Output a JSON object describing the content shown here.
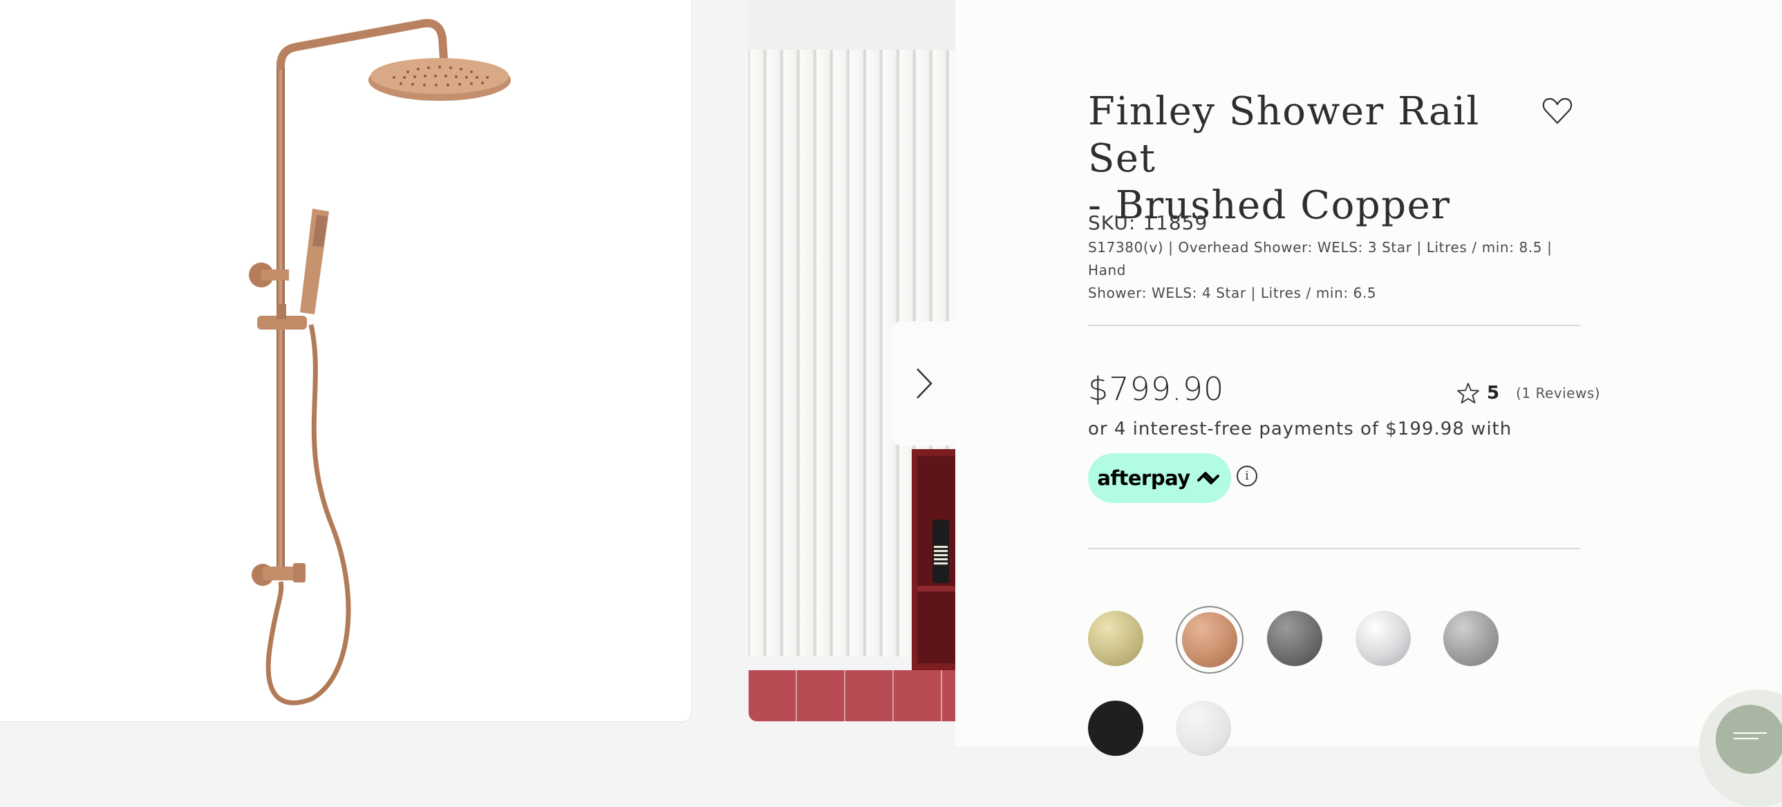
{
  "product": {
    "title_line1": "Finley Shower Rail Set",
    "title_line2": "- Brushed Copper",
    "sku": "SKU: 11859",
    "spec_line1": "S17380(v) | Overhead Shower: WELS: 3 Star | Litres / min: 8.5 | Hand",
    "spec_line2": "Shower: WELS: 4 Star | Litres / min: 6.5",
    "price": "$799.90",
    "rating_value": "5",
    "rating_reviews": "(1 Reviews)",
    "installments": "or 4 interest-free payments of $199.98 with",
    "afterpay_label": "afterpay",
    "info_glyph": "i"
  },
  "icons": {
    "wishlist": "heart-icon",
    "rating": "star-icon",
    "carousel_next": "chevron-right-icon",
    "menu": "menu-icon"
  },
  "swatches": [
    {
      "name": "brushed-brass",
      "color": "#c8bd85",
      "selected": false
    },
    {
      "name": "brushed-copper",
      "color": "#c98f6c",
      "selected": true
    },
    {
      "name": "gunmetal",
      "color": "#6e6e6e",
      "selected": false
    },
    {
      "name": "chrome",
      "color": "#d9d9dc",
      "selected": false
    },
    {
      "name": "brushed-nickel",
      "color": "#9e9e9e",
      "selected": false
    },
    {
      "name": "matte-black",
      "color": "#1f1f1f",
      "selected": false
    },
    {
      "name": "matte-white",
      "color": "#e6e6e6",
      "selected": false
    }
  ],
  "colors": {
    "afterpay_mint": "#b2fce4",
    "copper": "#b9805d"
  }
}
